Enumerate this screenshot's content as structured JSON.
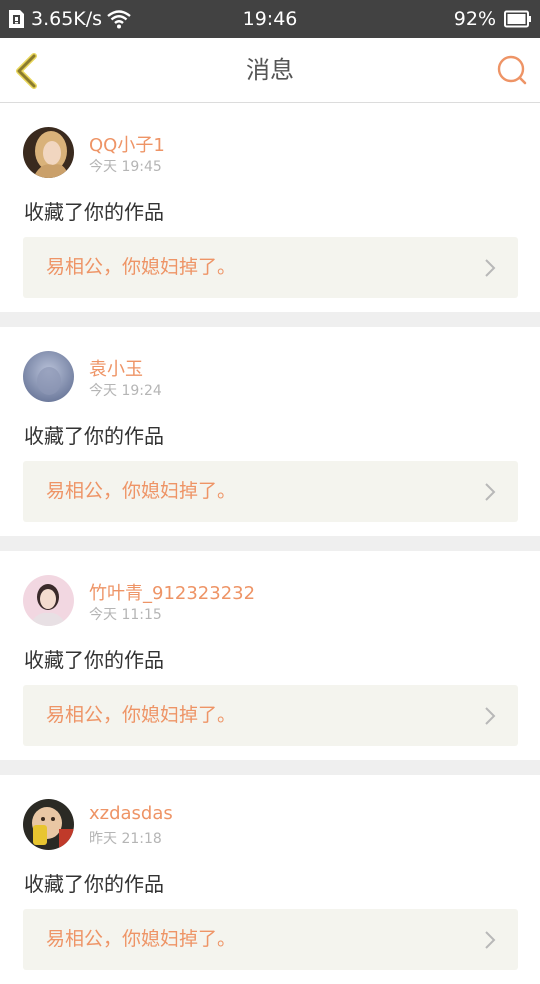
{
  "status_bar": {
    "network_speed": "3.65K/s",
    "time": "19:46",
    "battery": "92%",
    "icons": [
      "sim-icon",
      "wifi-icon",
      "battery-icon"
    ]
  },
  "header": {
    "title": "消息",
    "back_icon": "chevron-left-icon",
    "search_icon": "search-icon"
  },
  "colors": {
    "accent": "#ee9466",
    "back_icon": "#8a7b2e",
    "card_bg": "#ffffff",
    "work_bg": "#f4f4ee",
    "page_bg": "#efefef"
  },
  "messages": [
    {
      "user": "QQ小子1",
      "time": "今天 19:45",
      "action": "收藏了你的作品",
      "work_title": "易相公，你媳妇掉了。"
    },
    {
      "user": "袁小玉",
      "time": "今天 19:24",
      "action": "收藏了你的作品",
      "work_title": "易相公，你媳妇掉了。"
    },
    {
      "user": "竹叶青_912323232",
      "time": "今天 11:15",
      "action": "收藏了你的作品",
      "work_title": "易相公，你媳妇掉了。"
    },
    {
      "user": "xzdasdas",
      "time": "昨天 21:18",
      "action": "收藏了你的作品",
      "work_title": "易相公，你媳妇掉了。"
    }
  ]
}
